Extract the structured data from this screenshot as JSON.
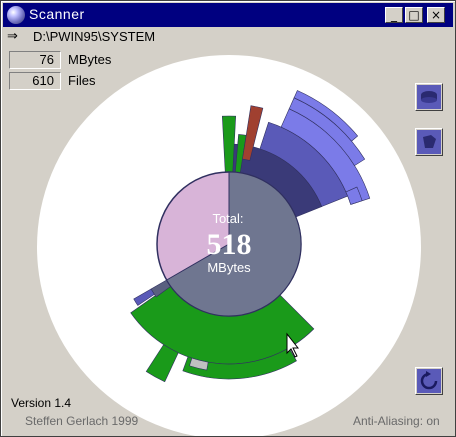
{
  "window": {
    "title": "Scanner"
  },
  "titlebar_buttons": {
    "minimize": "_",
    "maximize": "□",
    "close": "×"
  },
  "path": {
    "arrow": "⇒",
    "text": "D:\\PWIN95\\SYSTEM"
  },
  "stats": {
    "size_value": "76",
    "size_label": "MBytes",
    "files_value": "610",
    "files_label": "Files"
  },
  "center": {
    "label": "Total:",
    "value": "518",
    "unit": "MBytes"
  },
  "footer": {
    "version": "Version 1.4",
    "author": "Steffen Gerlach 1999",
    "antialias": "Anti-Aliasing: on"
  },
  "colors": {
    "titlebar": "#000080",
    "center_pink": "#d8b4d8",
    "center_slate": "#6f7690",
    "green": "#1a9a1a",
    "blue_light": "#7b7be8",
    "blue_mid": "#5a5ab8",
    "blue_dark": "#3a3a78",
    "brown": "#a04030"
  },
  "icons": {
    "title": "sphere-icon",
    "zoom_out": "disk-drive-icon",
    "folder": "folder-drive-icon",
    "refresh": "refresh-icon"
  }
}
